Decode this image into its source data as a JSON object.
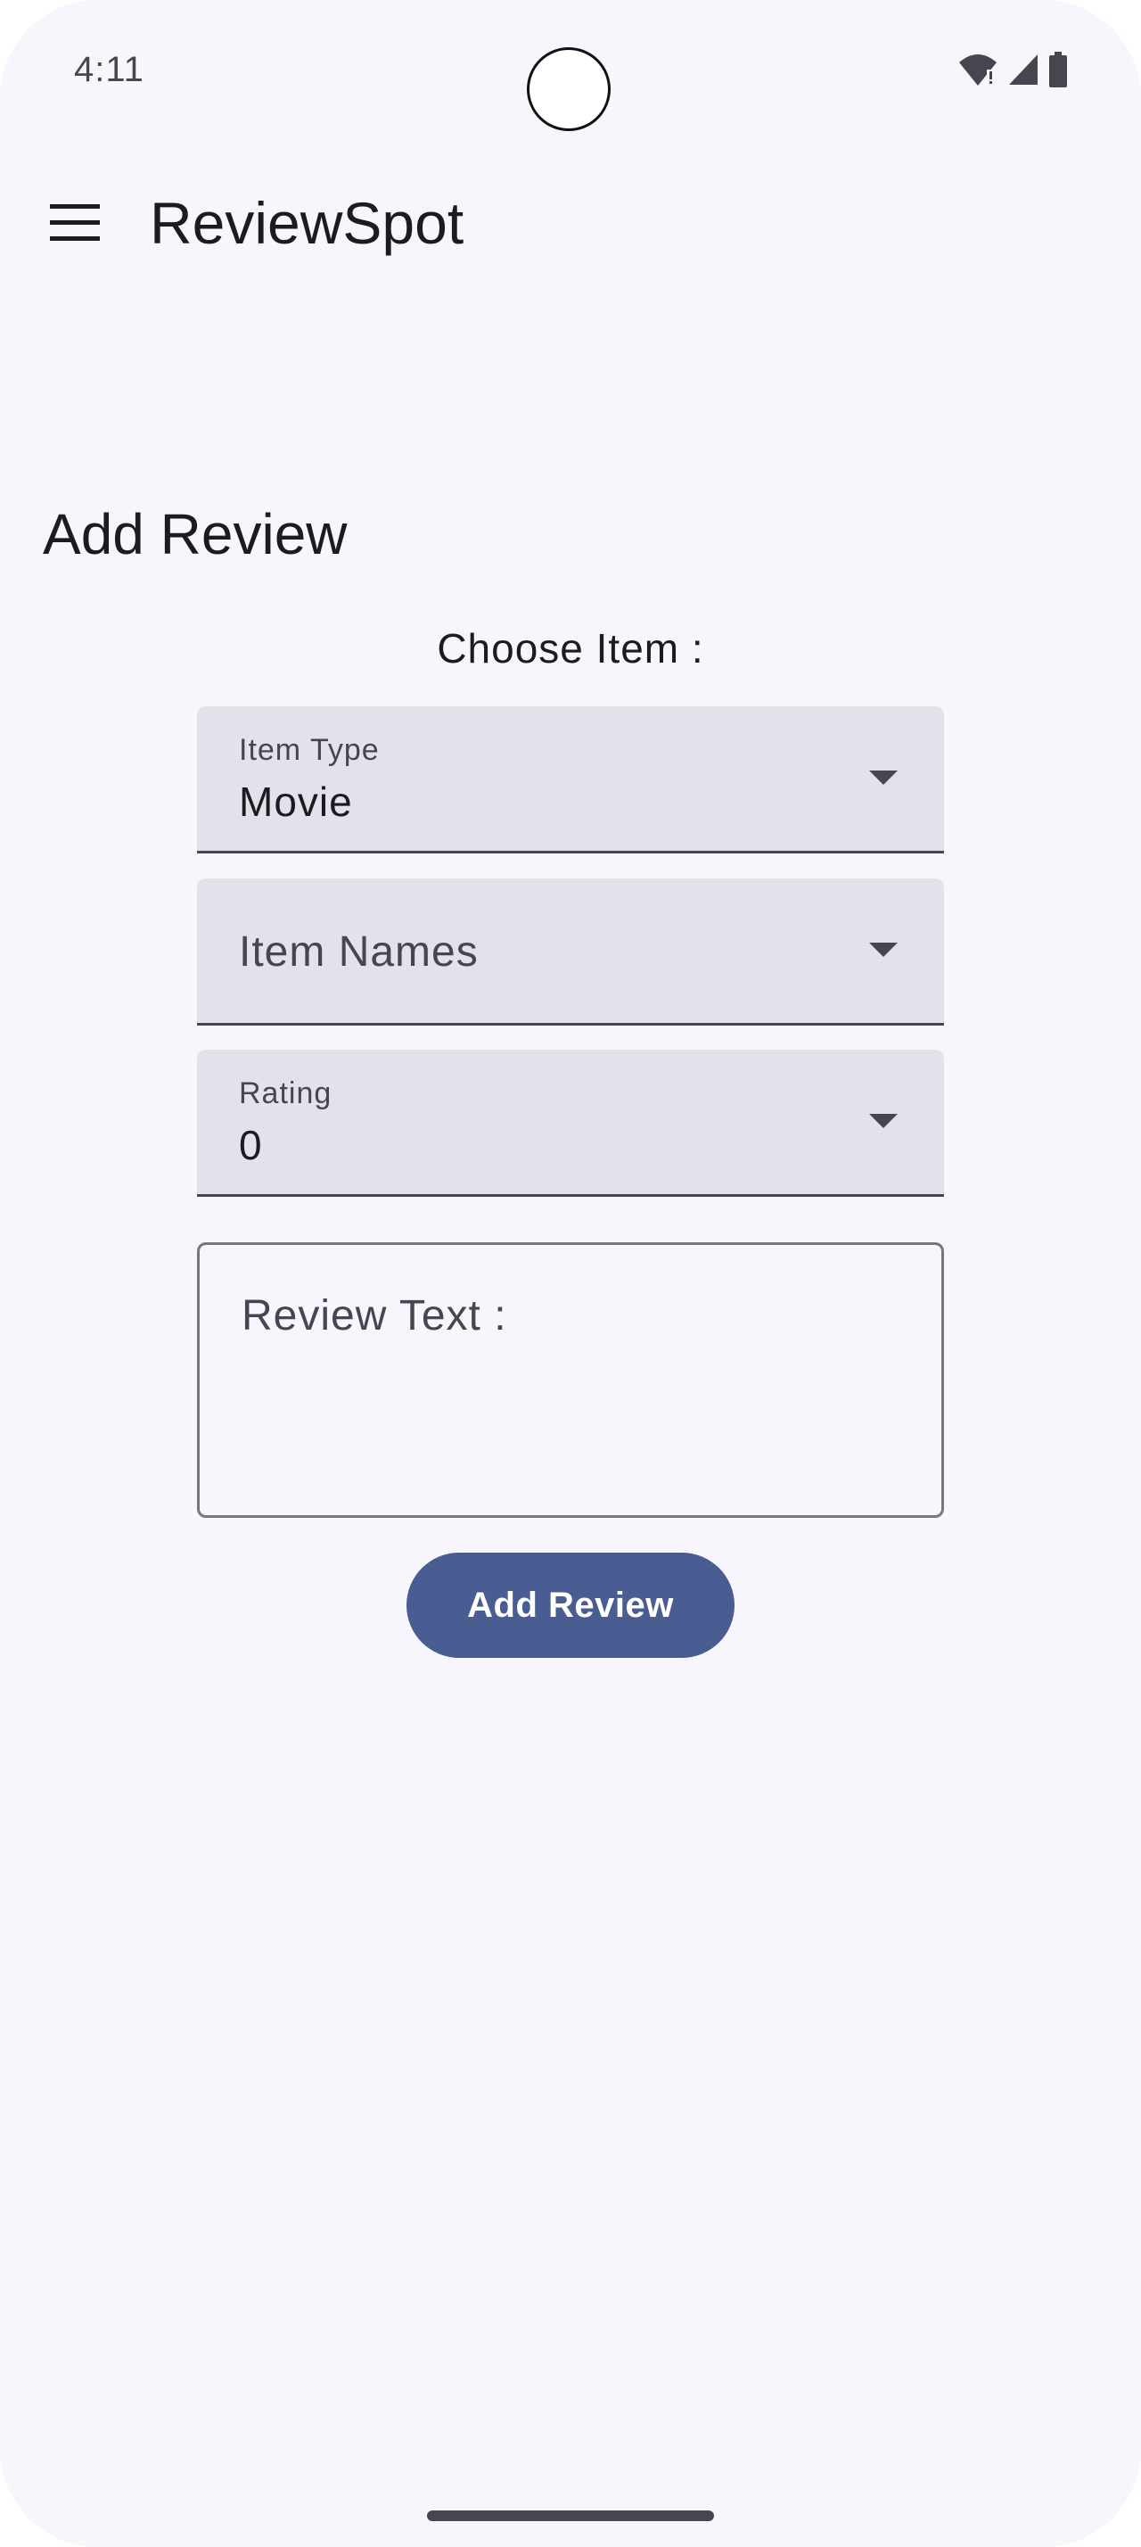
{
  "status_bar": {
    "time": "4:11"
  },
  "app_bar": {
    "title": "ReviewSpot",
    "menu_icon": "hamburger-menu-icon"
  },
  "page": {
    "heading": "Add Review",
    "choose_label": "Choose Item :"
  },
  "form": {
    "item_type": {
      "label": "Item Type",
      "value": "Movie"
    },
    "item_names": {
      "placeholder": "Item Names"
    },
    "rating": {
      "label": "Rating",
      "value": "0"
    },
    "review_text": {
      "placeholder": "Review Text :"
    },
    "submit_label": "Add Review"
  },
  "colors": {
    "background": "#f7f6fc",
    "field_fill": "#e2e2ea",
    "primary_button": "#4a5d93",
    "text": "#1b1b21"
  }
}
